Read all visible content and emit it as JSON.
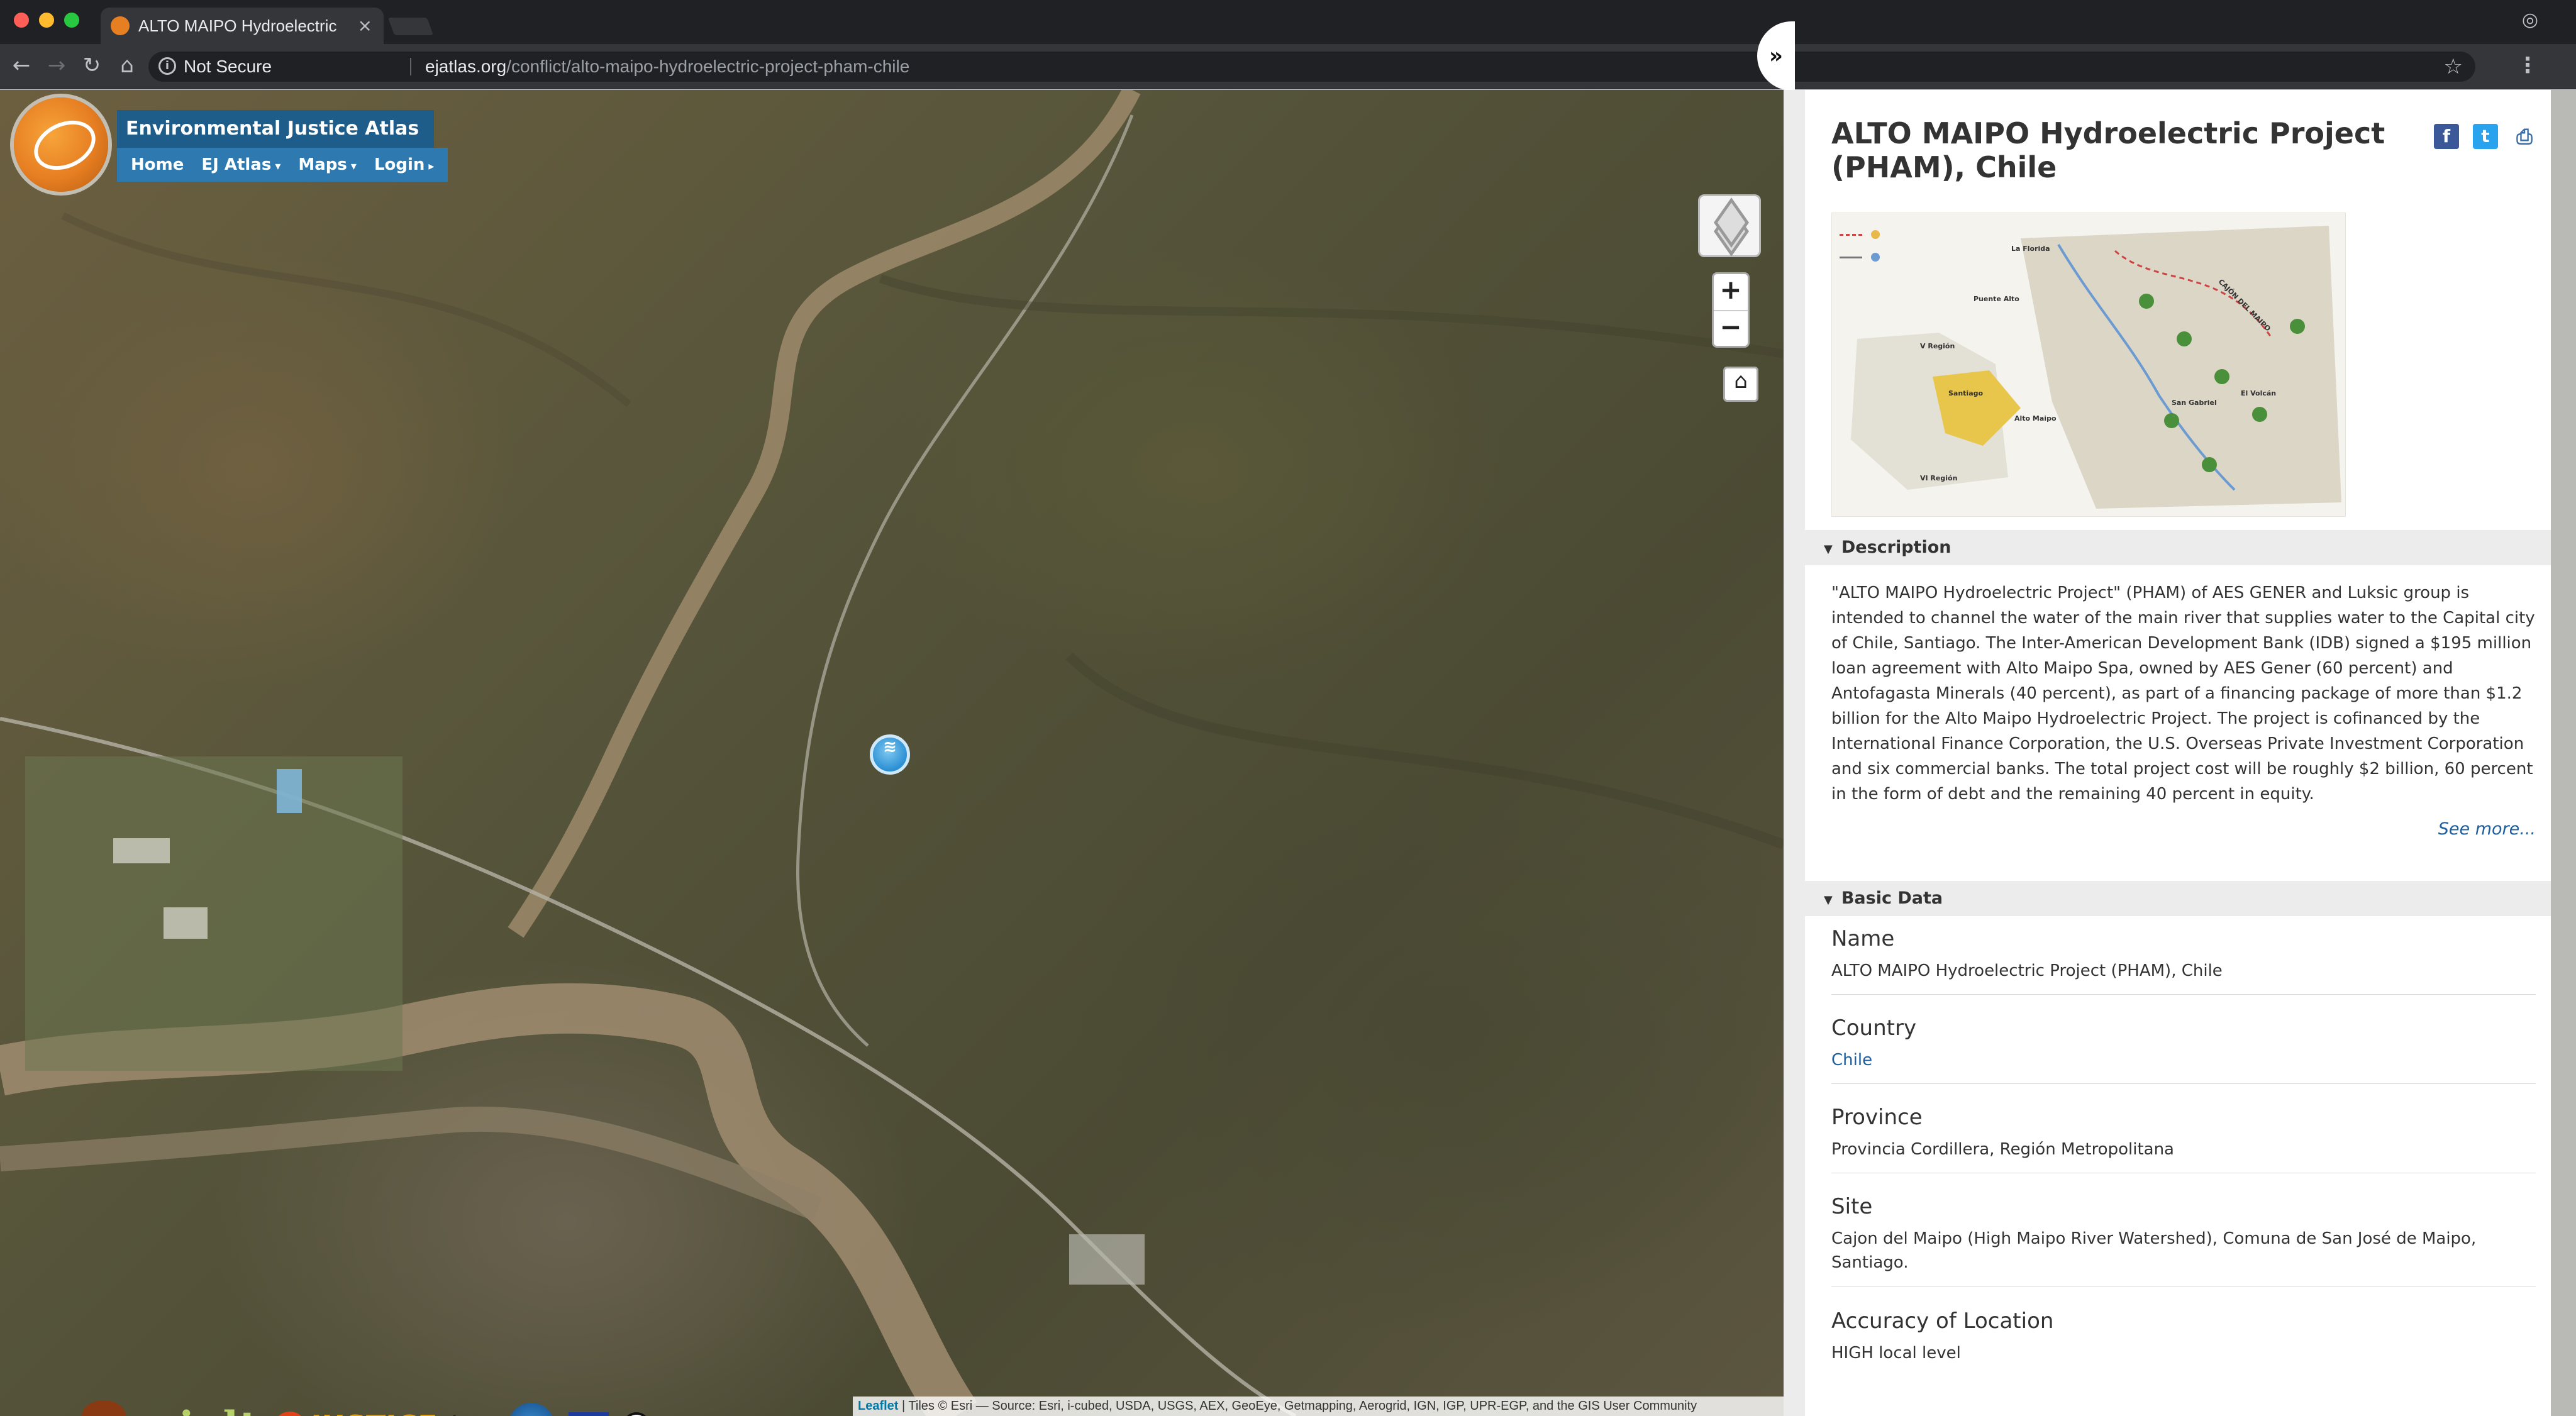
{
  "browser": {
    "tab_title": "ALTO MAIPO Hydroelectric Pro",
    "security_label": "Not Secure",
    "url_domain": "ejatlas.org",
    "url_path": "/conflict/alto-maipo-hydroelectric-project-pham-chile"
  },
  "site": {
    "title": "Environmental Justice Atlas",
    "nav": {
      "home": "Home",
      "ej_atlas": "EJ Atlas",
      "maps": "Maps",
      "login": "Login"
    }
  },
  "map": {
    "zoom_in": "+",
    "zoom_out": "−",
    "logos": {
      "ejolt": "ejolt",
      "envjustice": "JUSTICE",
      "icta": "icta"
    },
    "attribution_leaflet": "Leaflet",
    "attribution_rest": " | Tiles © Esri — Source: Esri, i-cubed, USDA, USGS, AEX, GeoEye, Getmapping, Aerogrid, IGN, IGP, UPR-EGP, and the GIS User Community"
  },
  "panel": {
    "title": "ALTO MAIPO Hydroelectric Project (PHAM), Chile",
    "description_header": "Description",
    "description": "\"ALTO MAIPO Hydroelectric Project\" (PHAM) of AES GENER and Luksic group is intended to channel the water of the main river that supplies water to the Capital city of Chile, Santiago. The Inter-American Development Bank (IDB) signed a $195 million loan agreement with Alto Maipo Spa, owned by AES Gener (60 percent) and Antofagasta Minerals (40 percent), as part of a financing package of more than $1.2 billion for the Alto Maipo Hydroelectric Project. The project is cofinanced by the International Finance Corporation, the U.S. Overseas Private Investment Corporation and six commercial banks. The total project cost will be roughly $2 billion, 60 percent in the form of debt and the remaining 40 percent in equity.",
    "see_more": "See more...",
    "basic_data_header": "Basic Data",
    "fields": {
      "name_label": "Name",
      "name_value": "ALTO MAIPO Hydroelectric Project (PHAM), Chile",
      "country_label": "Country",
      "country_value": "Chile",
      "province_label": "Province",
      "province_value": "Provincia Cordillera, Región Metropolitana",
      "site_label": "Site",
      "site_value": "Cajon del Maipo (High Maipo River Watershed), Comuna de San José de Maipo, Santiago.",
      "accuracy_label": "Accuracy of Location",
      "accuracy_value": "HIGH local level"
    },
    "thumbnail_map": {
      "labels": [
        "La Florida",
        "Puente Alto",
        "Santiago",
        "Alto Maipo",
        "V Región",
        "VI Región",
        "CAJÓN DEL MAIPO",
        "San Gabriel",
        "El Volcán"
      ]
    }
  }
}
